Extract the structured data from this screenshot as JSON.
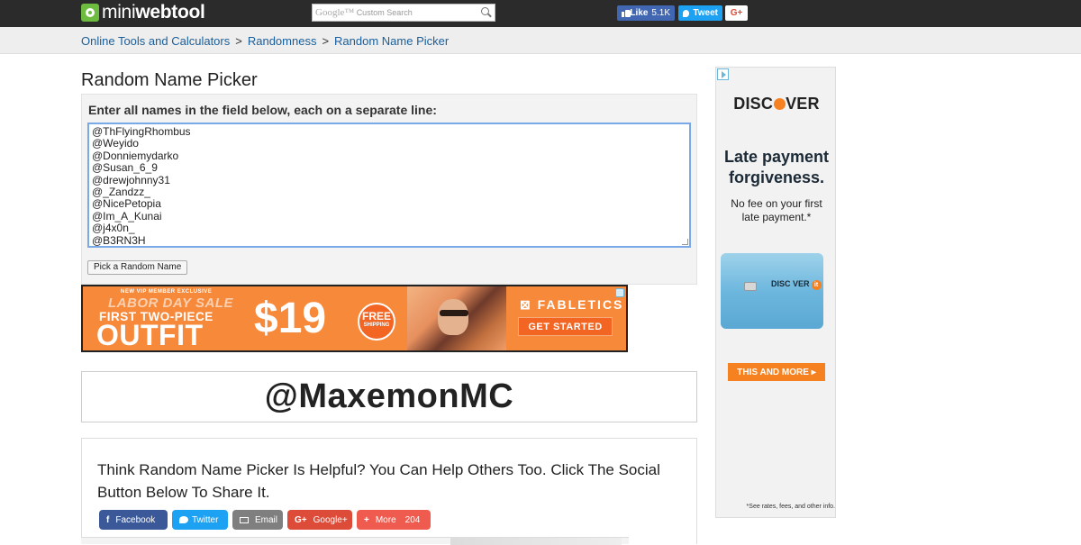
{
  "topbar": {
    "logo_mini": "mini",
    "logo_webtool": "webtool",
    "search_google": "Google™",
    "search_placeholder": "Custom Search",
    "like_label": "Like",
    "like_count": "5.1K",
    "tweet_label": "Tweet",
    "gplus_label": "G+"
  },
  "breadcrumb": {
    "items": [
      "Online Tools and Calculators",
      "Randomness",
      "Random Name Picker"
    ],
    "separator": ">"
  },
  "page": {
    "title": "Random Name Picker"
  },
  "form": {
    "label": "Enter all names in the field below, each on a separate line:",
    "names": [
      "@ThFlyingRhombus",
      "@Weyido",
      "@Donniemydarko",
      "@Susan_6_9",
      "@drewjohnny31",
      "@_Zandzz_",
      "@NicePetopia",
      "@Im_A_Kunai",
      "@j4x0n_",
      "@B3RN3H"
    ],
    "button_label": "Pick a Random Name"
  },
  "banner_ad": {
    "small_text": "NEW VIP MEMBER EXCLUSIVE",
    "labor_text": "LABOR DAY SALE",
    "first_text": "FIRST TWO-PIECE",
    "outfit_text": "OUTFIT",
    "price": "$19",
    "free_1": "FREE",
    "free_2": "SHIPPING",
    "brand": "⊠ FABLETICS",
    "cta": "GET STARTED"
  },
  "result": {
    "name": "@MaxemonMC"
  },
  "share": {
    "text": "Think Random Name Picker Is Helpful? You Can Help Others Too. Click The Social Button Below To Share It.",
    "buttons": {
      "facebook": "Facebook",
      "twitter": "Twitter",
      "email": "Email",
      "googleplus": "Google+",
      "more": "More",
      "more_count": "204"
    },
    "icons": {
      "facebook": "f",
      "googleplus": "G+",
      "more": "+"
    }
  },
  "side_ad": {
    "logo_pre": "DISC",
    "logo_post": "VER",
    "headline": "Late payment forgiveness.",
    "sub": "No fee on your first late payment.*",
    "card_brand": "DISC VER",
    "card_it": "it",
    "cta": "THIS AND MORE ▸",
    "fine_print": "*See rates, fees, and other info."
  },
  "colors": {
    "topbar": "#2b2b2b",
    "link": "#1a5e9a",
    "facebook": "#3b5998",
    "twitter": "#1da1f2",
    "googleplus": "#dd4b39",
    "discover_orange": "#f68121",
    "banner_orange": "#f7893b"
  }
}
